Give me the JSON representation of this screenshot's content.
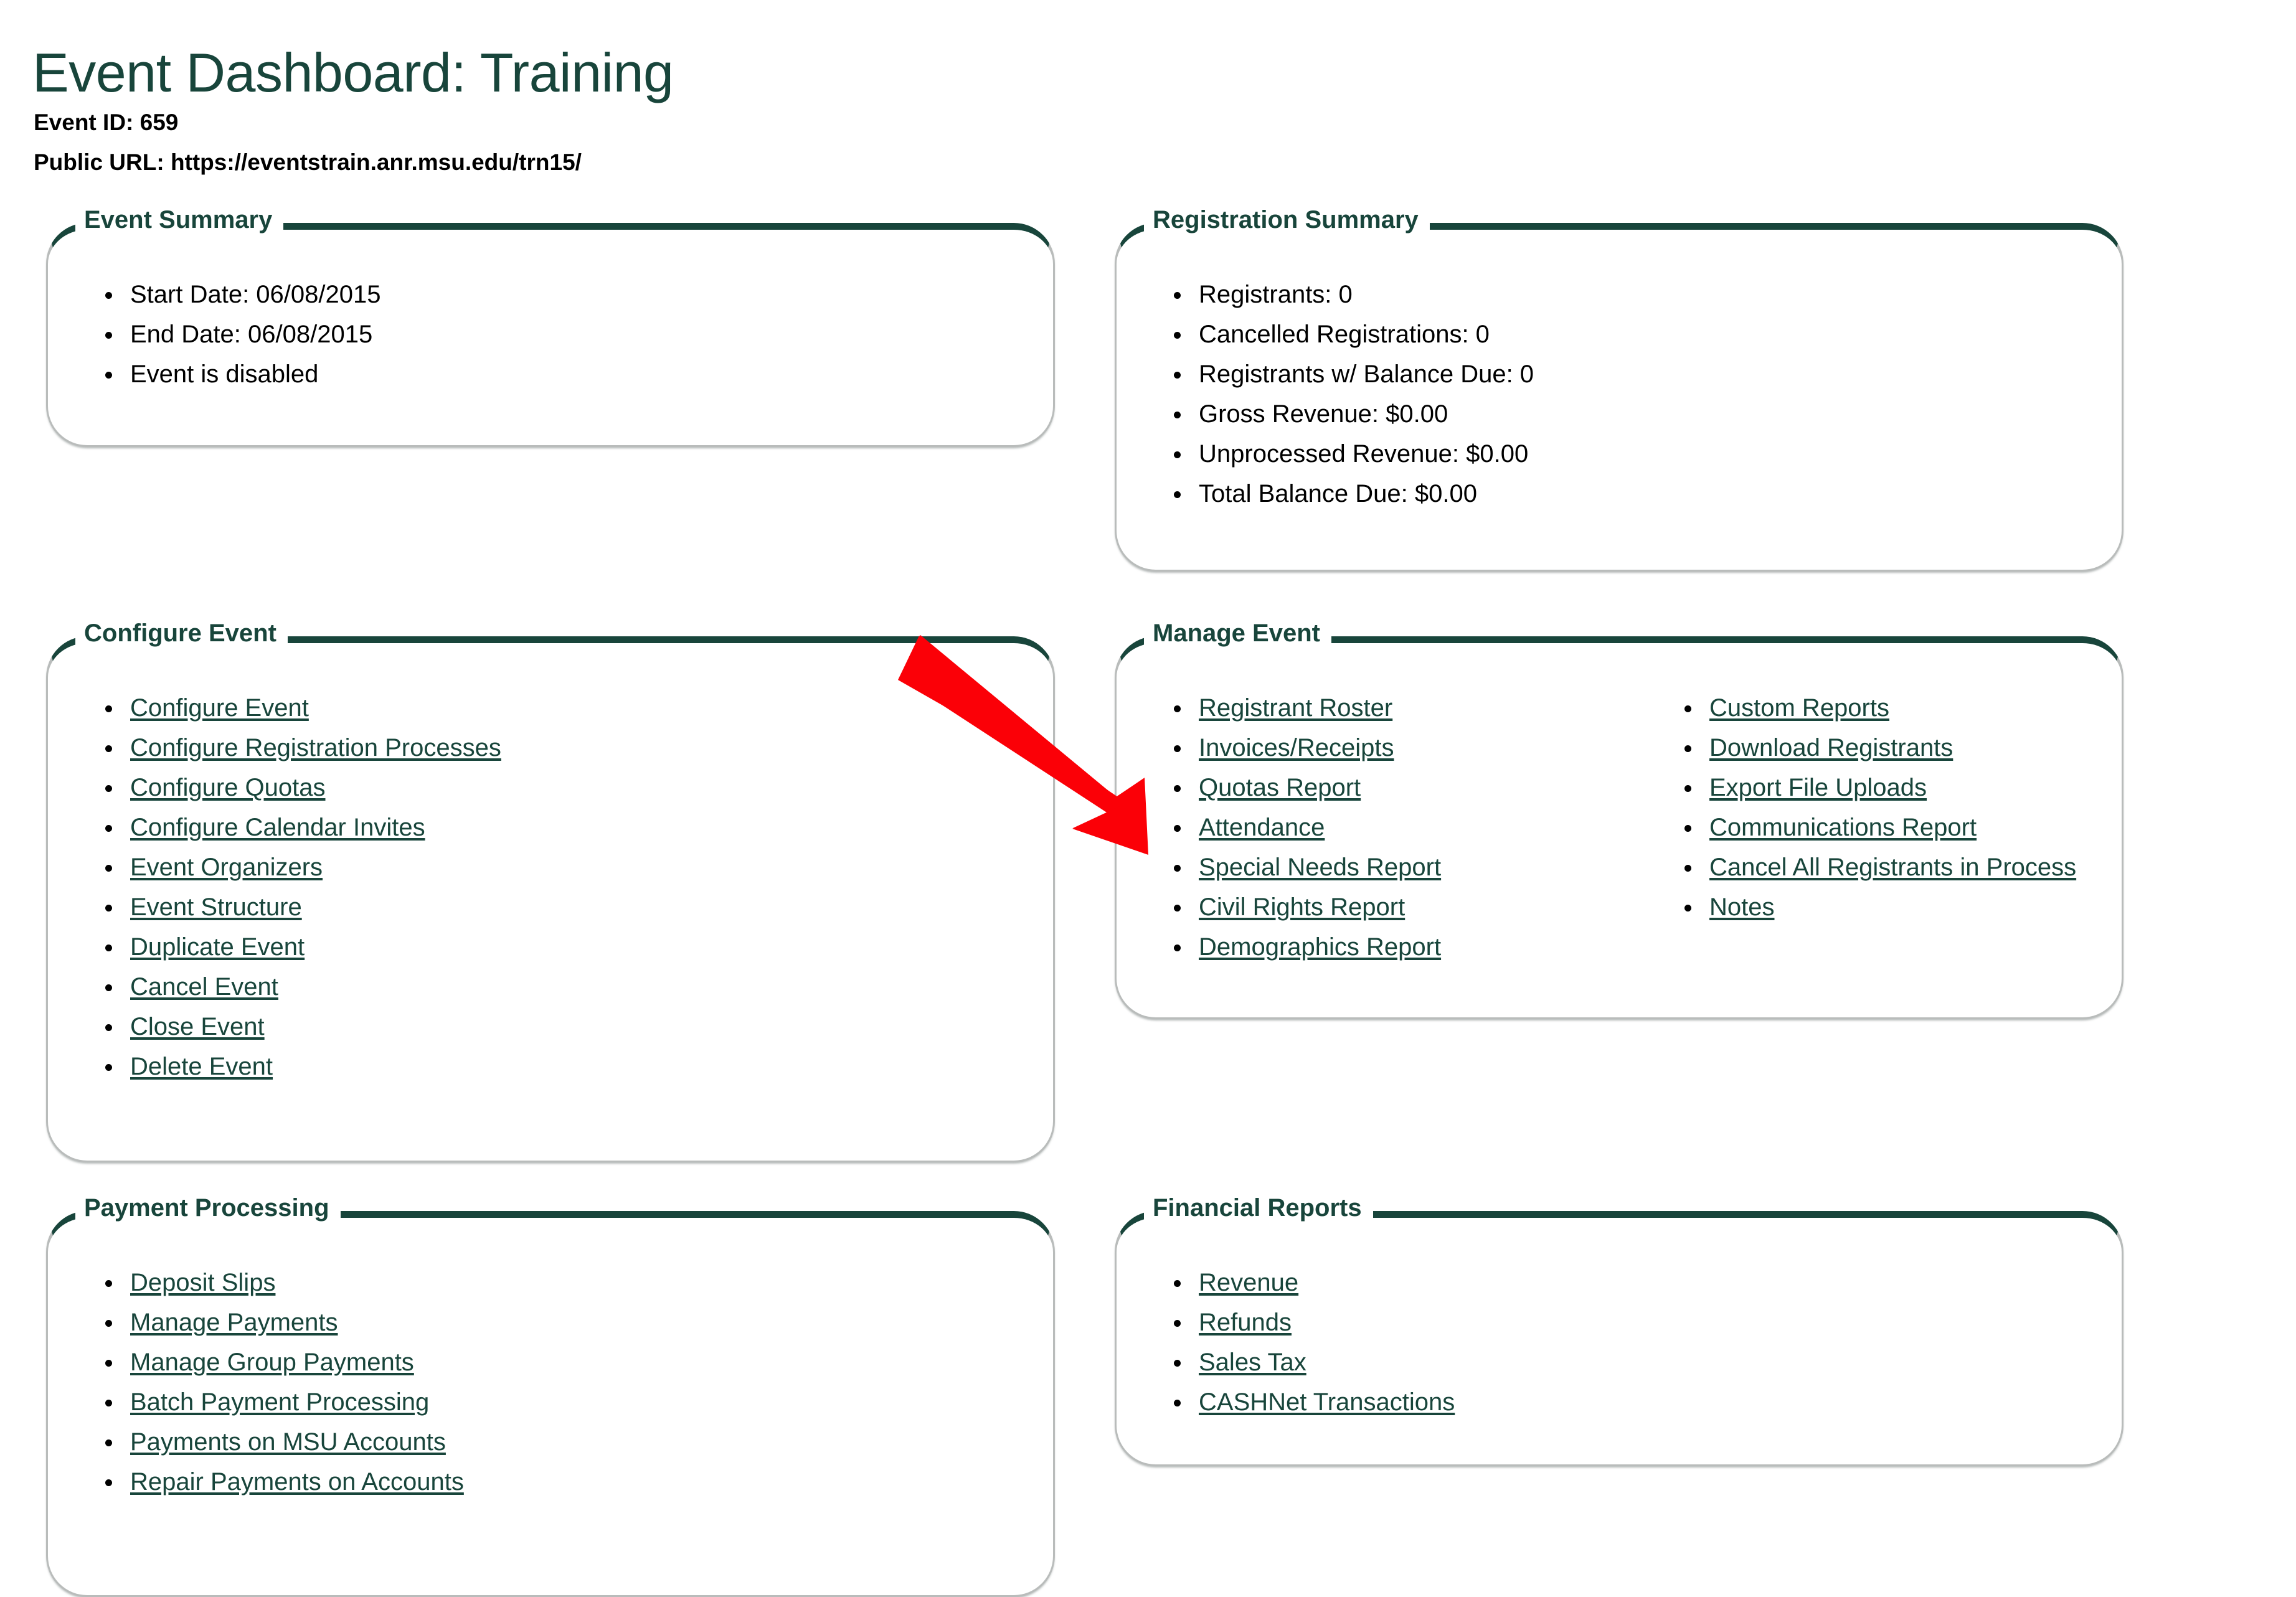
{
  "header": {
    "title": "Event Dashboard: Training",
    "event_id_label": "Event ID: 659",
    "public_url_label": "Public URL: https://eventstrain.anr.msu.edu/trn15/"
  },
  "theme": {
    "brand_green": "#18453B",
    "panel_border": "#b9bcbb",
    "annotation_red": "#FB0007",
    "text": "#000000",
    "background": "#FFFFFF"
  },
  "panels": {
    "event_summary": {
      "legend": "Event Summary",
      "items": [
        "Start Date: 06/08/2015",
        "End Date: 06/08/2015",
        "Event is disabled"
      ]
    },
    "registration_summary": {
      "legend": "Registration Summary",
      "items": [
        "Registrants: 0",
        "Cancelled Registrations: 0",
        "Registrants w/ Balance Due: 0",
        "Gross Revenue: $0.00",
        "Unprocessed Revenue: $0.00",
        "Total Balance Due: $0.00"
      ]
    },
    "configure_event": {
      "legend": "Configure Event",
      "links": [
        "Configure Event",
        "Configure Registration Processes",
        "Configure Quotas",
        "Configure Calendar Invites",
        "Event Organizers",
        "Event Structure",
        "Duplicate Event",
        "Cancel Event",
        "Close Event",
        "Delete Event"
      ]
    },
    "manage_event": {
      "legend": "Manage Event",
      "links_col1": [
        "Registrant Roster",
        "Invoices/Receipts",
        "Quotas Report",
        "Attendance",
        "Special Needs Report",
        "Civil Rights Report",
        "Demographics Report"
      ],
      "links_col2": [
        "Custom Reports",
        "Download Registrants",
        "Export File Uploads",
        "Communications Report",
        "Cancel All Registrants in Process",
        "Notes"
      ]
    },
    "payment_processing": {
      "legend": "Payment Processing",
      "links": [
        "Deposit Slips",
        "Manage Payments",
        "Manage Group Payments",
        "Batch Payment Processing",
        "Payments on MSU Accounts",
        "Repair Payments on Accounts"
      ]
    },
    "financial_reports": {
      "legend": "Financial Reports",
      "links": [
        "Revenue",
        "Refunds",
        "Sales Tax",
        "CASHNet Transactions"
      ]
    }
  },
  "annotation": {
    "arrow_icon": "red-arrow-down-right-icon",
    "points_at": "Quotas Report"
  }
}
